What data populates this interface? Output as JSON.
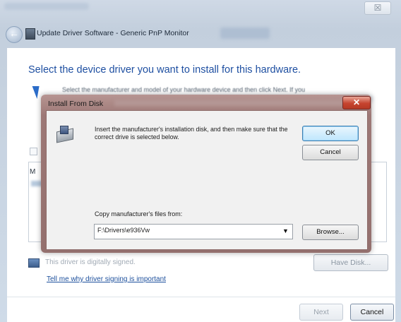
{
  "wizard": {
    "title": "Update Driver Software - Generic PnP Monitor",
    "heading": "Select the device driver you want to install for this hardware.",
    "instruction": "Select the manufacturer and model of your hardware device and then click Next. If you",
    "list_header": "M",
    "unsigned_text": "This driver is digitally signed.",
    "have_disk_label": "Have Disk...",
    "signing_link": "Tell me why driver signing is important",
    "next_label": "Next",
    "cancel_label": "Cancel",
    "close_glyph": "☒"
  },
  "dialog": {
    "title": "Install From Disk",
    "close_glyph": "✕",
    "message": "Insert the manufacturer's installation disk, and then make sure that the correct drive is selected below.",
    "ok_label": "OK",
    "cancel_label": "Cancel",
    "copy_label": "Copy manufacturer's files from:",
    "path_value": "F:\\Drivers\\e936Vw",
    "caret_glyph": "▼",
    "browse_label": "Browse..."
  },
  "icons": {
    "back": "back-arrow-icon",
    "monitor": "monitor-icon",
    "disk": "disk-drive-icon",
    "shield": "shield-icon"
  },
  "colors": {
    "heading_blue": "#1e4fa1",
    "link_blue": "#1c4f9c",
    "close_red": "#c6442f",
    "dialog_frame": "#9d7876"
  }
}
